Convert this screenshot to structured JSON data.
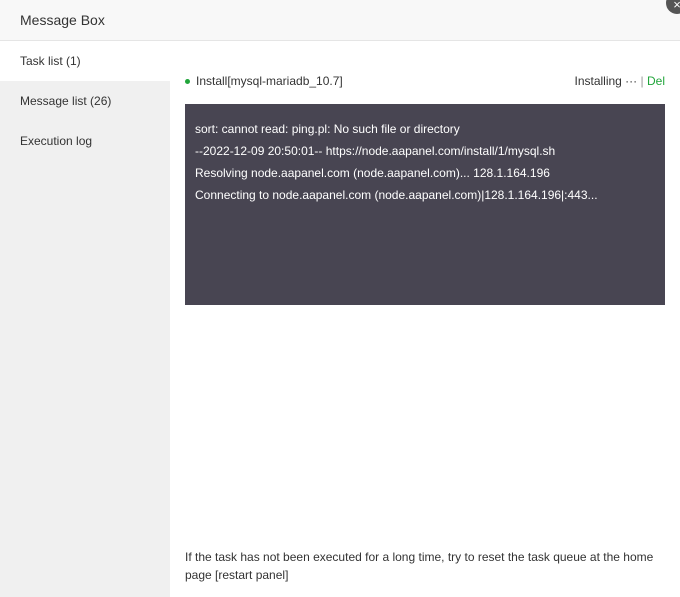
{
  "title": "Message Box",
  "sidebar": {
    "items": [
      {
        "label": "Task list (1)"
      },
      {
        "label": "Message list (26)"
      },
      {
        "label": "Execution log"
      }
    ]
  },
  "task": {
    "name": "Install[mysql-mariadb_10.7]",
    "status": "Installing ···",
    "separator": "|",
    "del": "Del"
  },
  "log": [
    "sort: cannot read: ping.pl: No such file or directory",
    "--2022-12-09 20:50:01-- https://node.aapanel.com/install/1/mysql.sh",
    "Resolving node.aapanel.com (node.aapanel.com)... 128.1.164.196",
    "Connecting to node.aapanel.com (node.aapanel.com)|128.1.164.196|:443..."
  ],
  "note": "If the task has not been executed for a long time, try to reset the task queue at the home page [restart panel]",
  "close_icon": "×"
}
